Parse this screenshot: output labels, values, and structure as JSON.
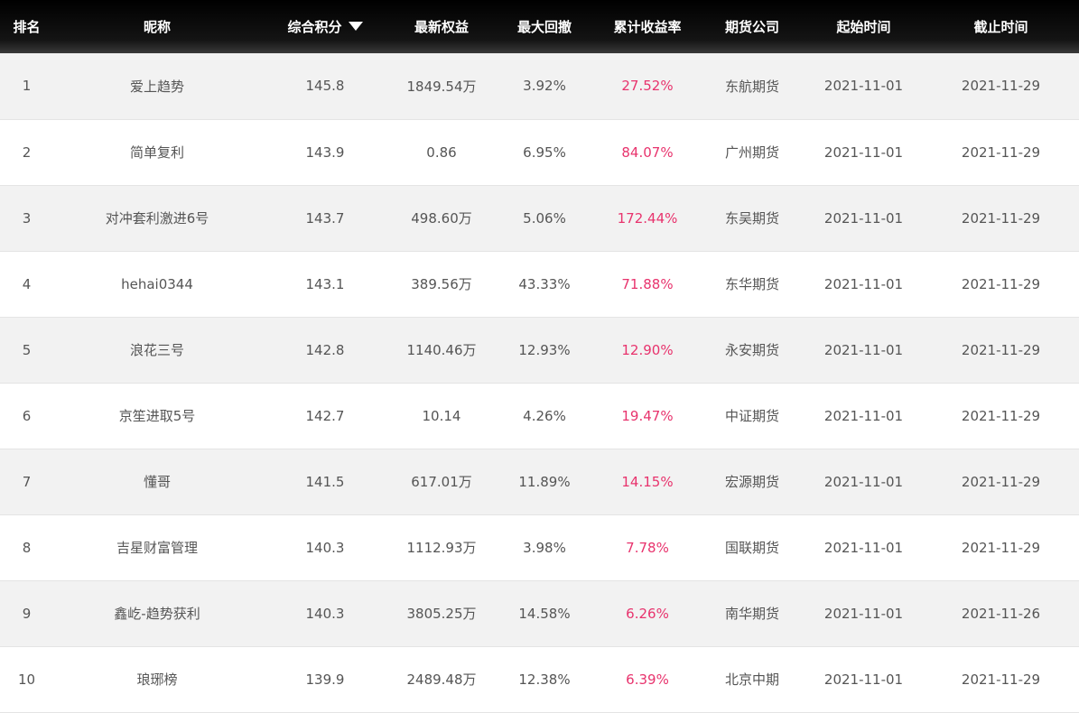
{
  "header": {
    "columns": [
      "排名",
      "昵称",
      "综合积分",
      "最新权益",
      "最大回撤",
      "累计收益率",
      "期货公司",
      "起始时间",
      "截止时间"
    ],
    "sort_icon": "caret-down-icon"
  },
  "colors": {
    "return_text": "#e8336d",
    "header_bg": "#000000",
    "row_alt": "#f2f2f2",
    "body_text": "#555555"
  },
  "rows": [
    {
      "rank": "1",
      "name": "爱上趋势",
      "score": "145.8",
      "equity": "1849.54万",
      "drawdown": "3.92%",
      "return": "27.52%",
      "company": "东航期货",
      "start": "2021-11-01",
      "end": "2021-11-29"
    },
    {
      "rank": "2",
      "name": "简单复利",
      "score": "143.9",
      "equity": "0.86",
      "drawdown": "6.95%",
      "return": "84.07%",
      "company": "广州期货",
      "start": "2021-11-01",
      "end": "2021-11-29"
    },
    {
      "rank": "3",
      "name": "对冲套利激进6号",
      "score": "143.7",
      "equity": "498.60万",
      "drawdown": "5.06%",
      "return": "172.44%",
      "company": "东吴期货",
      "start": "2021-11-01",
      "end": "2021-11-29"
    },
    {
      "rank": "4",
      "name": "hehai0344",
      "score": "143.1",
      "equity": "389.56万",
      "drawdown": "43.33%",
      "return": "71.88%",
      "company": "东华期货",
      "start": "2021-11-01",
      "end": "2021-11-29"
    },
    {
      "rank": "5",
      "name": "浪花三号",
      "score": "142.8",
      "equity": "1140.46万",
      "drawdown": "12.93%",
      "return": "12.90%",
      "company": "永安期货",
      "start": "2021-11-01",
      "end": "2021-11-29"
    },
    {
      "rank": "6",
      "name": "京笙进取5号",
      "score": "142.7",
      "equity": "10.14",
      "drawdown": "4.26%",
      "return": "19.47%",
      "company": "中证期货",
      "start": "2021-11-01",
      "end": "2021-11-29"
    },
    {
      "rank": "7",
      "name": "懂哥",
      "score": "141.5",
      "equity": "617.01万",
      "drawdown": "11.89%",
      "return": "14.15%",
      "company": "宏源期货",
      "start": "2021-11-01",
      "end": "2021-11-29"
    },
    {
      "rank": "8",
      "name": "吉星财富管理",
      "score": "140.3",
      "equity": "1112.93万",
      "drawdown": "3.98%",
      "return": "7.78%",
      "company": "国联期货",
      "start": "2021-11-01",
      "end": "2021-11-29"
    },
    {
      "rank": "9",
      "name": "鑫屹-趋势获利",
      "score": "140.3",
      "equity": "3805.25万",
      "drawdown": "14.58%",
      "return": "6.26%",
      "company": "南华期货",
      "start": "2021-11-01",
      "end": "2021-11-26"
    },
    {
      "rank": "10",
      "name": "琅琊榜",
      "score": "139.9",
      "equity": "2489.48万",
      "drawdown": "12.38%",
      "return": "6.39%",
      "company": "北京中期",
      "start": "2021-11-01",
      "end": "2021-11-29"
    }
  ]
}
